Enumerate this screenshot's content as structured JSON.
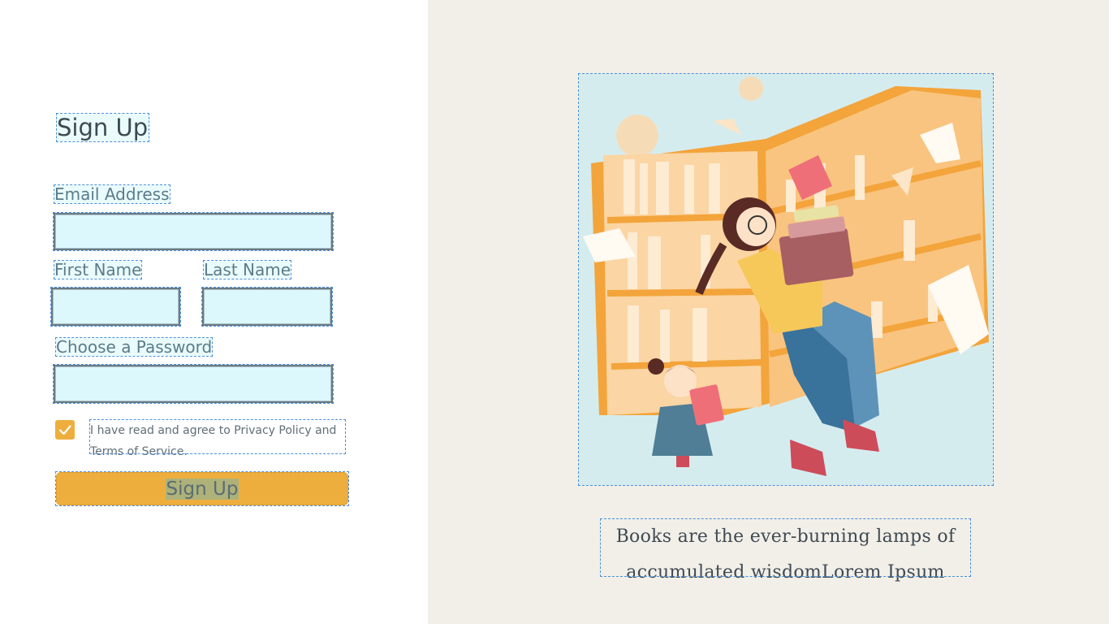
{
  "form": {
    "title": "Sign Up",
    "email_label": "Email Address",
    "email_value": "",
    "first_name_label": "First Name",
    "first_name_value": "",
    "last_name_label": "Last Name",
    "last_name_value": "",
    "password_label": "Choose a Password",
    "password_value": "",
    "agree_checked": true,
    "agree_text": "I have read and agree to Privacy Policy and Terms of Service.",
    "submit_label": "Sign Up"
  },
  "aside": {
    "quote": "Books are the ever-burning lamps of accumulated wisdomLorem Ipsum",
    "illustration_icon": "reading-girls-bookshelf-illustration"
  },
  "colors": {
    "accent": "#eeae3e",
    "input_bg": "#dcf8fd",
    "panel_bg": "#f2efe9",
    "illustration_bg": "#d5ecef"
  }
}
